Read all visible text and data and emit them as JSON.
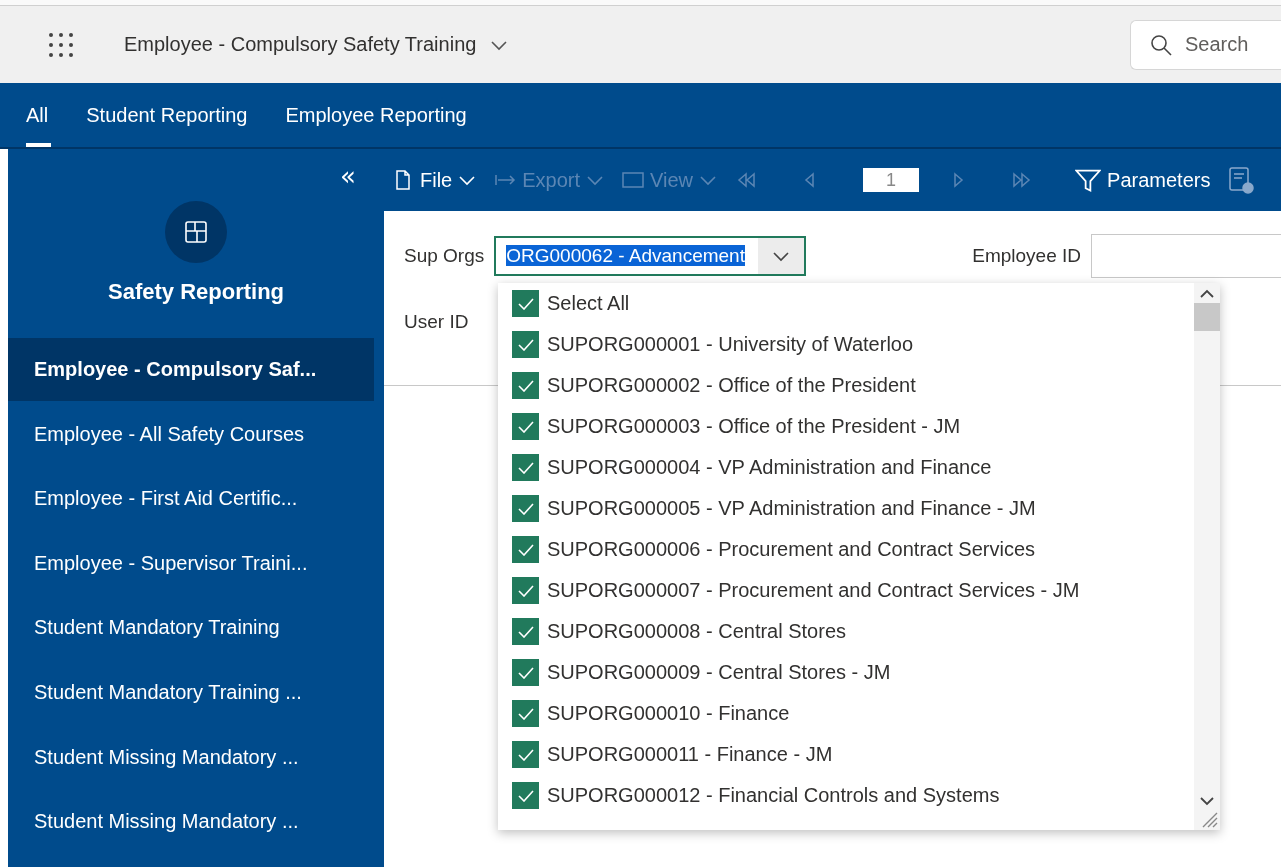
{
  "header": {
    "title": "Employee - Compulsory Safety Training",
    "search": {
      "placeholder": "Search"
    }
  },
  "nav_tabs": [
    {
      "label": "All",
      "selected": true
    },
    {
      "label": "Student Reporting",
      "selected": false
    },
    {
      "label": "Employee Reporting",
      "selected": false
    }
  ],
  "sidebar": {
    "collapse_glyph": "«",
    "title": "Safety Reporting",
    "items": [
      {
        "label": "Employee - Compulsory Saf...",
        "selected": true
      },
      {
        "label": "Employee - All Safety Courses",
        "selected": false
      },
      {
        "label": "Employee - First Aid Certific...",
        "selected": false
      },
      {
        "label": "Employee - Supervisor Traini...",
        "selected": false
      },
      {
        "label": "Student Mandatory Training",
        "selected": false
      },
      {
        "label": "Student Mandatory Training ...",
        "selected": false
      },
      {
        "label": "Student Missing Mandatory ...",
        "selected": false
      },
      {
        "label": "Student Missing Mandatory ...",
        "selected": false
      }
    ]
  },
  "toolbar": {
    "items": [
      {
        "kind": "menu",
        "label": "File",
        "disabled": false
      },
      {
        "kind": "menu",
        "label": "Export",
        "disabled": true
      },
      {
        "kind": "menu",
        "label": "View",
        "disabled": true
      },
      {
        "kind": "nav",
        "disabled": true
      },
      {
        "kind": "nav",
        "disabled": true
      },
      {
        "kind": "page",
        "value": "1"
      },
      {
        "kind": "nav",
        "disabled": true
      },
      {
        "kind": "nav",
        "disabled": true
      },
      {
        "kind": "button",
        "label": "Parameters",
        "disabled": false
      }
    ]
  },
  "parameters": {
    "sup_orgs": {
      "label": "Sup Orgs",
      "value": "ORG000062 - Advancement"
    },
    "employee_id": {
      "label": "Employee ID"
    },
    "user_id": {
      "label": "User ID"
    }
  },
  "dropdown": {
    "options": [
      {
        "label": "Select All",
        "checked": true
      },
      {
        "label": "SUPORG000001 - University of Waterloo",
        "checked": true
      },
      {
        "label": "SUPORG000002 - Office of the President",
        "checked": true
      },
      {
        "label": "SUPORG000003 - Office of the President - JM",
        "checked": true
      },
      {
        "label": "SUPORG000004 - VP Administration and Finance",
        "checked": true
      },
      {
        "label": "SUPORG000005 - VP Administration and Finance - JM",
        "checked": true
      },
      {
        "label": "SUPORG000006 - Procurement and Contract Services",
        "checked": true
      },
      {
        "label": "SUPORG000007 - Procurement and Contract Services - JM",
        "checked": true
      },
      {
        "label": "SUPORG000008 - Central Stores",
        "checked": true
      },
      {
        "label": "SUPORG000009 - Central Stores - JM",
        "checked": true
      },
      {
        "label": "SUPORG000010 - Finance",
        "checked": true
      },
      {
        "label": "SUPORG000011 - Finance - JM",
        "checked": true
      },
      {
        "label": "SUPORG000012 - Financial Controls and Systems",
        "checked": true
      }
    ]
  }
}
